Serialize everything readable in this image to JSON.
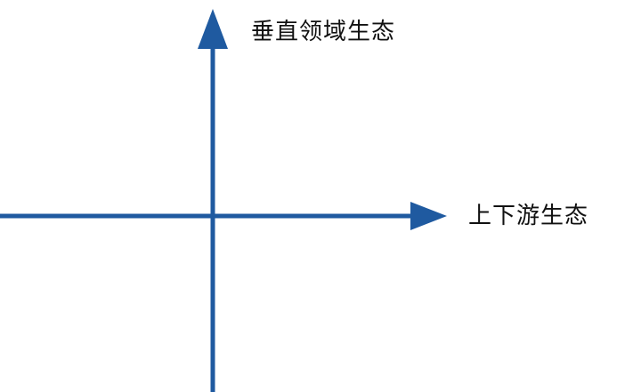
{
  "axes": {
    "vertical_label": "垂直领域生态",
    "horizontal_label": "上下游生态",
    "color": "#1f5aa0"
  }
}
